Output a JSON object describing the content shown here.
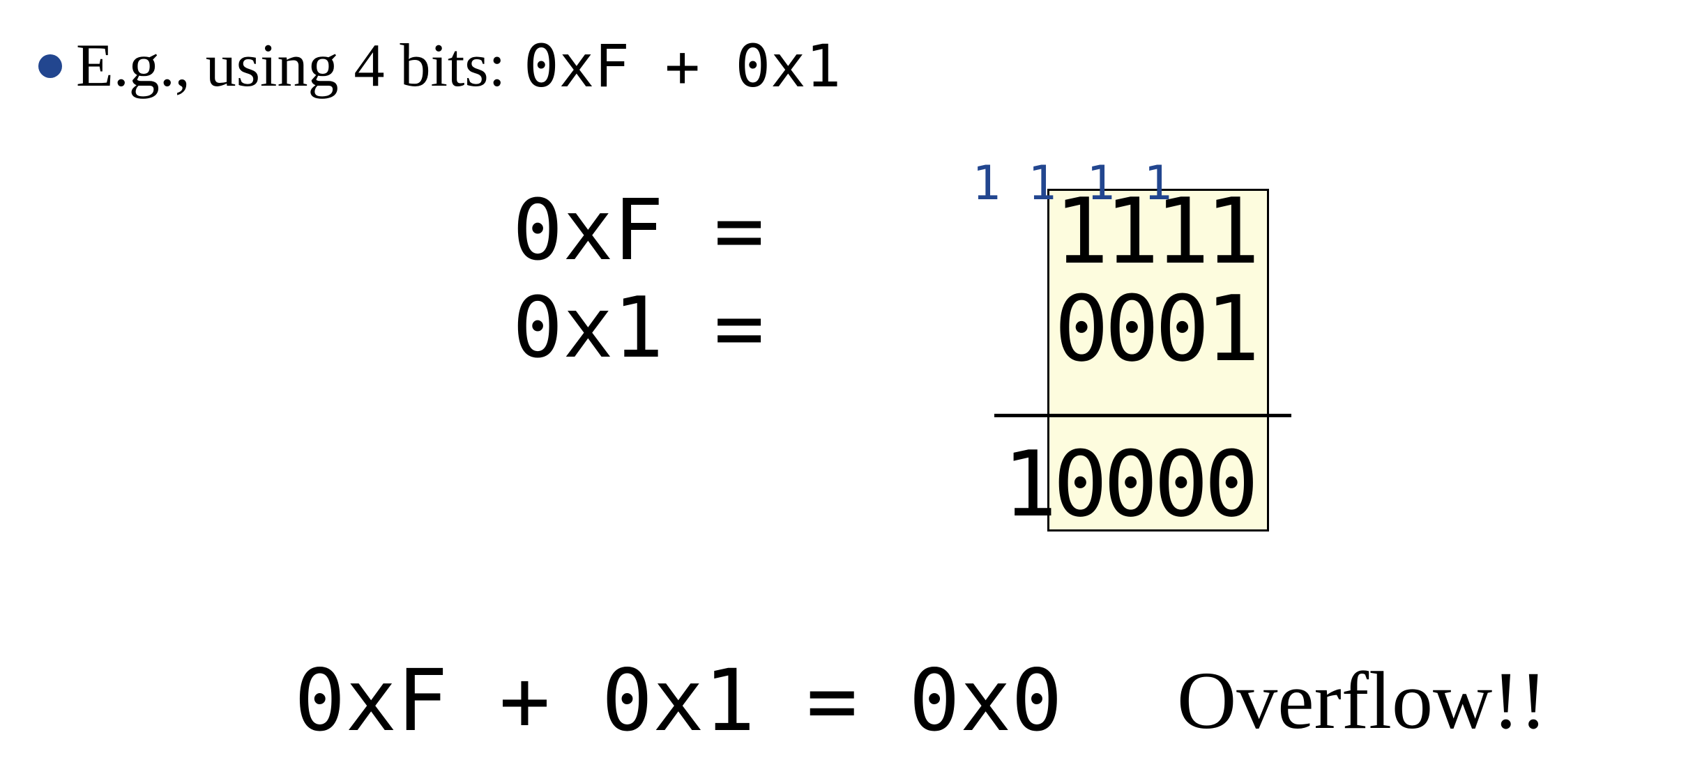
{
  "bullet": {
    "text": "E.g., using 4 bits:",
    "code": "0xF + 0x1",
    "bullet_color": "#22468f"
  },
  "addition": {
    "operand1_label": "0xF =",
    "operand2_label": "0x1 =",
    "carries": [
      "1",
      "1",
      "1",
      "1"
    ],
    "carry_color": "#22468f",
    "operand1_bits": "1111",
    "operand2_bits": "0001",
    "result_bits": "10000",
    "box_fill_color": "#fdfcde"
  },
  "summary": {
    "equation": "0xF + 0x1 = 0x0",
    "note": "Overflow!!"
  }
}
